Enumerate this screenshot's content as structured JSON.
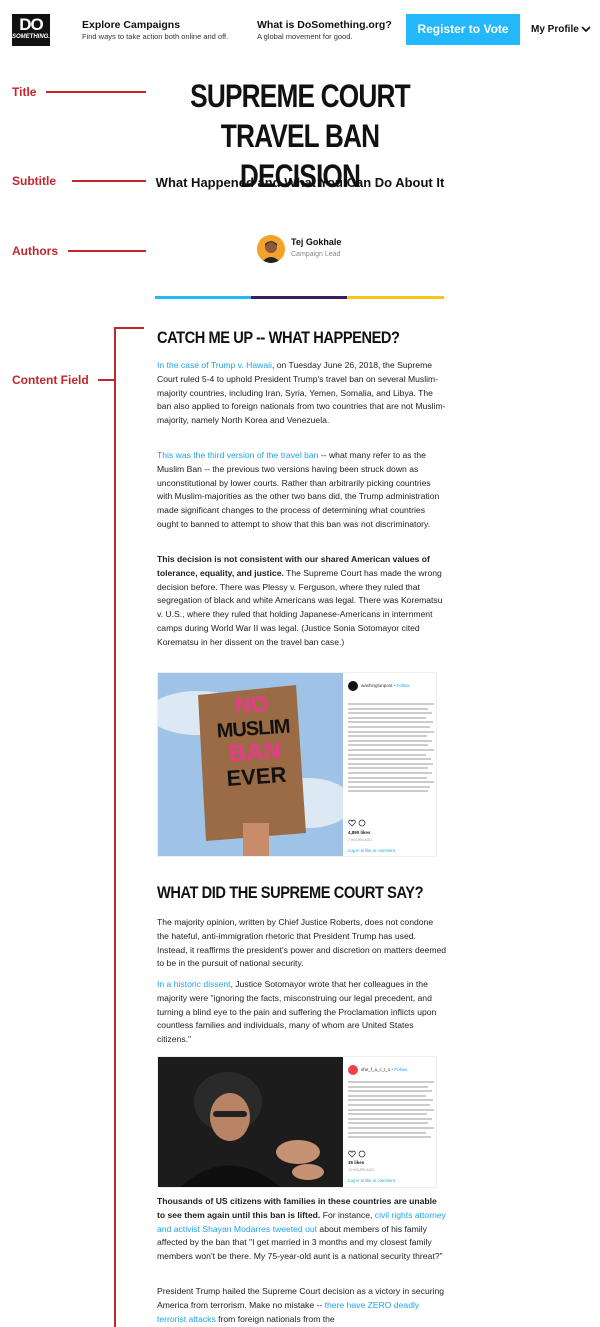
{
  "header": {
    "logo_line1": "DO",
    "logo_line2": "SOMETHING.ORG",
    "nav": [
      {
        "title": "Explore Campaigns",
        "subtitle": "Find ways to take action both online and off."
      },
      {
        "title": "What is DoSomething.org?",
        "subtitle": "A global movement for good."
      }
    ],
    "register_label": "Register to Vote",
    "profile_label": "My Profile"
  },
  "annotations": {
    "title": "Title",
    "subtitle": "Subtitle",
    "authors": "Authors",
    "content": "Content Field"
  },
  "article": {
    "title": "SUPREME COURT TRAVEL BAN DECISION",
    "subtitle": "What Happened and What You Can Do About It",
    "author_name": "Tej Gokhale",
    "author_role": "Campaign Lead",
    "section1_heading": "CATCH ME UP -- WHAT HAPPENED?",
    "p1_link": "In the case of Trump v. Hawaii",
    "p1_text": ", on Tuesday June 26, 2018, the Supreme Court ruled 5-4 to uphold President Trump's travel ban on several Muslim-majority countries, including Iran, Syria, Yemen, Somalia, and Libya. The ban also applied to foreign nationals from two countries that are not Muslim-majority, namely North Korea and Venezuela.",
    "p2_link": "This was the third version of the travel ban",
    "p2_text": " -- what many refer to as the Muslim Ban -- the previous two versions having been struck down as unconstitutional by lower courts. Rather than arbitrarily picking countries with Muslim-majorities as the other two bans did, the Trump administration made significant changes to the process of determining what countries ought to banned to attempt to show that this ban was not discriminatory.",
    "p3_bold": "This decision is not consistent with our shared American values of tolerance, equality, and justice.",
    "p3_text": " The Supreme Court has made the wrong decision before. There was Plessy v. Ferguson, where they ruled that segregation of black and white Americans was legal. There was Korematsu v. U.S., where they ruled that holding Japanese-Americans in internment camps during World War II was legal. (Justice Sonia Sotomayor cited Korematsu in her dissent on the travel ban case.)",
    "embed1": {
      "sign_line1": "NO",
      "sign_line2": "MUSLIM",
      "sign_line3": "BAN",
      "sign_line4": "EVER",
      "account": "washingtonpost",
      "follow": "• Follow",
      "likes": "4,890 likes",
      "time": "2 HOURS AGO",
      "login": "Log in to like or comment."
    },
    "section2_heading": "WHAT DID THE SUPREME COURT SAY?",
    "p4_text": "The majority opinion, written by Chief Justice Roberts, does not condone the hateful, anti-immigration rhetoric that President Trump has used. Instead, it reaffirms the president's power and discretion on matters deemed to be in the pursuit of national security.",
    "p5_link": "In a historic dissent",
    "p5_text": ", Justice Sotomayor wrote that her colleagues in the majority were \"ignoring the facts, misconstruing our legal precedent, and turning a blind eye to the pain and suffering the Proclamation inflicts upon countless families and individuals, many of whom are United States citizens.\"",
    "embed2": {
      "account": "she_f_a_c_t_s",
      "follow": "• Follow",
      "likes": "35 likes",
      "time": "10 HOURS AGO",
      "login": "Log in to like or comment."
    },
    "p6_bold": "Thousands of US citizens with families in these countries are unable to see them again until this ban is lifted.",
    "p6_text1": " For instance, ",
    "p6_link": "civil rights attorney and activist Shayan Modarres tweeted out",
    "p6_text2": " about members of his family affected by the ban that \"I get married in 3 months and my closest family members won't be there. My 75-year-old aunt is a national security threat?\"",
    "p7_text1": "President Trump hailed the Supreme Court decision as a victory in securing America from terrorism. Make no mistake -- ",
    "p7_link": "there have ZERO deadly terrorist attacks",
    "p7_text2": " from foreign nationals from the"
  },
  "colors": {
    "accent_blue": "#23b7fb",
    "annotation_red": "#c0272d",
    "bar_blue": "#23b7fb",
    "bar_purple": "#3b1d5c",
    "bar_yellow": "#f9c51d",
    "link": "#1fa3e7"
  }
}
